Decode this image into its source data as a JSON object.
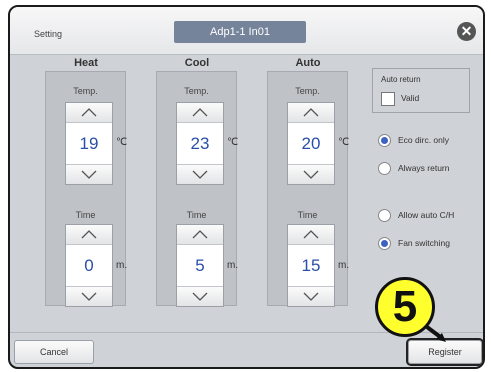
{
  "window": {
    "title": "Setting",
    "unit_id": "Adp1-1 In01",
    "close_icon": "close-icon"
  },
  "columns": [
    {
      "header": "Heat",
      "temp_label": "Temp.",
      "temp_value": "19",
      "temp_unit": "℃",
      "time_label": "Time",
      "time_value": "0",
      "time_unit": "m."
    },
    {
      "header": "Cool",
      "temp_label": "Temp.",
      "temp_value": "23",
      "temp_unit": "℃",
      "time_label": "Time",
      "time_value": "5",
      "time_unit": "m."
    },
    {
      "header": "Auto",
      "temp_label": "Temp.",
      "temp_value": "20",
      "temp_unit": "℃",
      "time_label": "Time",
      "time_value": "15",
      "time_unit": "m."
    }
  ],
  "auto_return": {
    "title": "Auto return",
    "valid_label": "Valid",
    "valid_checked": false
  },
  "return_options": [
    {
      "label": "Eco dirc. only",
      "selected": true
    },
    {
      "label": "Always return",
      "selected": false
    }
  ],
  "switch_options": [
    {
      "label": "Allow auto C/H",
      "selected": false
    },
    {
      "label": "Fan switching",
      "selected": true
    }
  ],
  "footer": {
    "cancel_label": "Cancel",
    "register_label": "Register"
  },
  "callout": {
    "number": "5",
    "color": "#ffff2e"
  },
  "colors": {
    "value_text": "#2a4fa8",
    "unit_id_bg": "#75849b",
    "radio_on": "#3e62c0"
  }
}
